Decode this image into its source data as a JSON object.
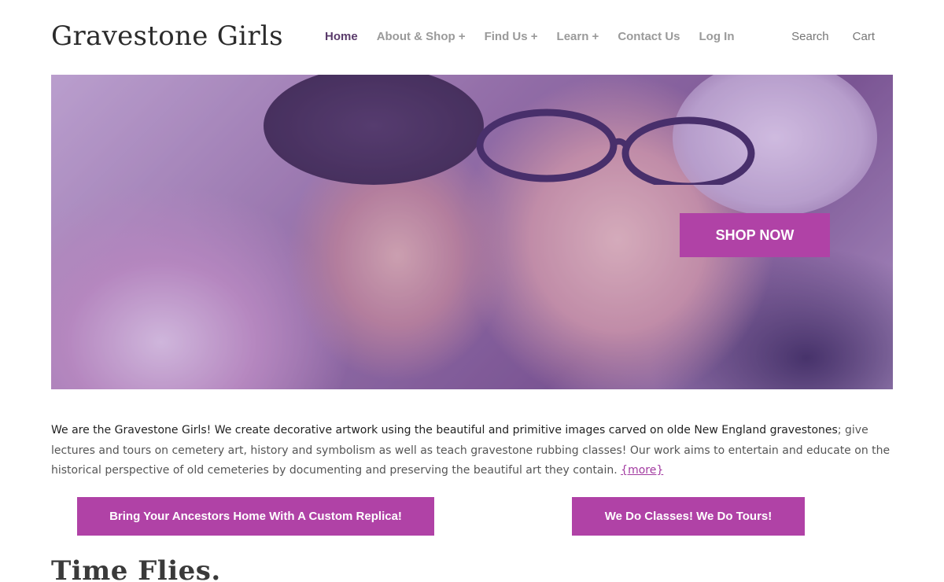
{
  "site": {
    "title": "Gravestone Girls"
  },
  "nav": {
    "items": [
      {
        "label": "Home",
        "active": true
      },
      {
        "label": "About & Shop +"
      },
      {
        "label": "Find Us +"
      },
      {
        "label": "Learn +"
      },
      {
        "label": "Contact Us"
      },
      {
        "label": "Log In"
      }
    ],
    "search_label": "Search",
    "cart_label": "Cart"
  },
  "hero": {
    "cta_label": "SHOP NOW"
  },
  "intro": {
    "lead": "We are the Gravestone Girls! We create decorative artwork using the beautiful and primitive images carved on olde New England gravestones",
    "body": "; give lectures and tours on cemetery art, history and symbolism as well as teach gravestone rubbing classes! Our work aims to entertain and educate on the historical perspective of old cemeteries by documenting and preserving the beautiful art they contain. ",
    "more_link": "{more}"
  },
  "cta_buttons": {
    "replica": "Bring Your Ancestors Home With A Custom Replica!",
    "classes": "We Do Classes!  We Do Tours!"
  },
  "section": {
    "title": "Time Flies."
  },
  "colors": {
    "accent": "#b042a6",
    "active_nav": "#5a3b6b"
  }
}
